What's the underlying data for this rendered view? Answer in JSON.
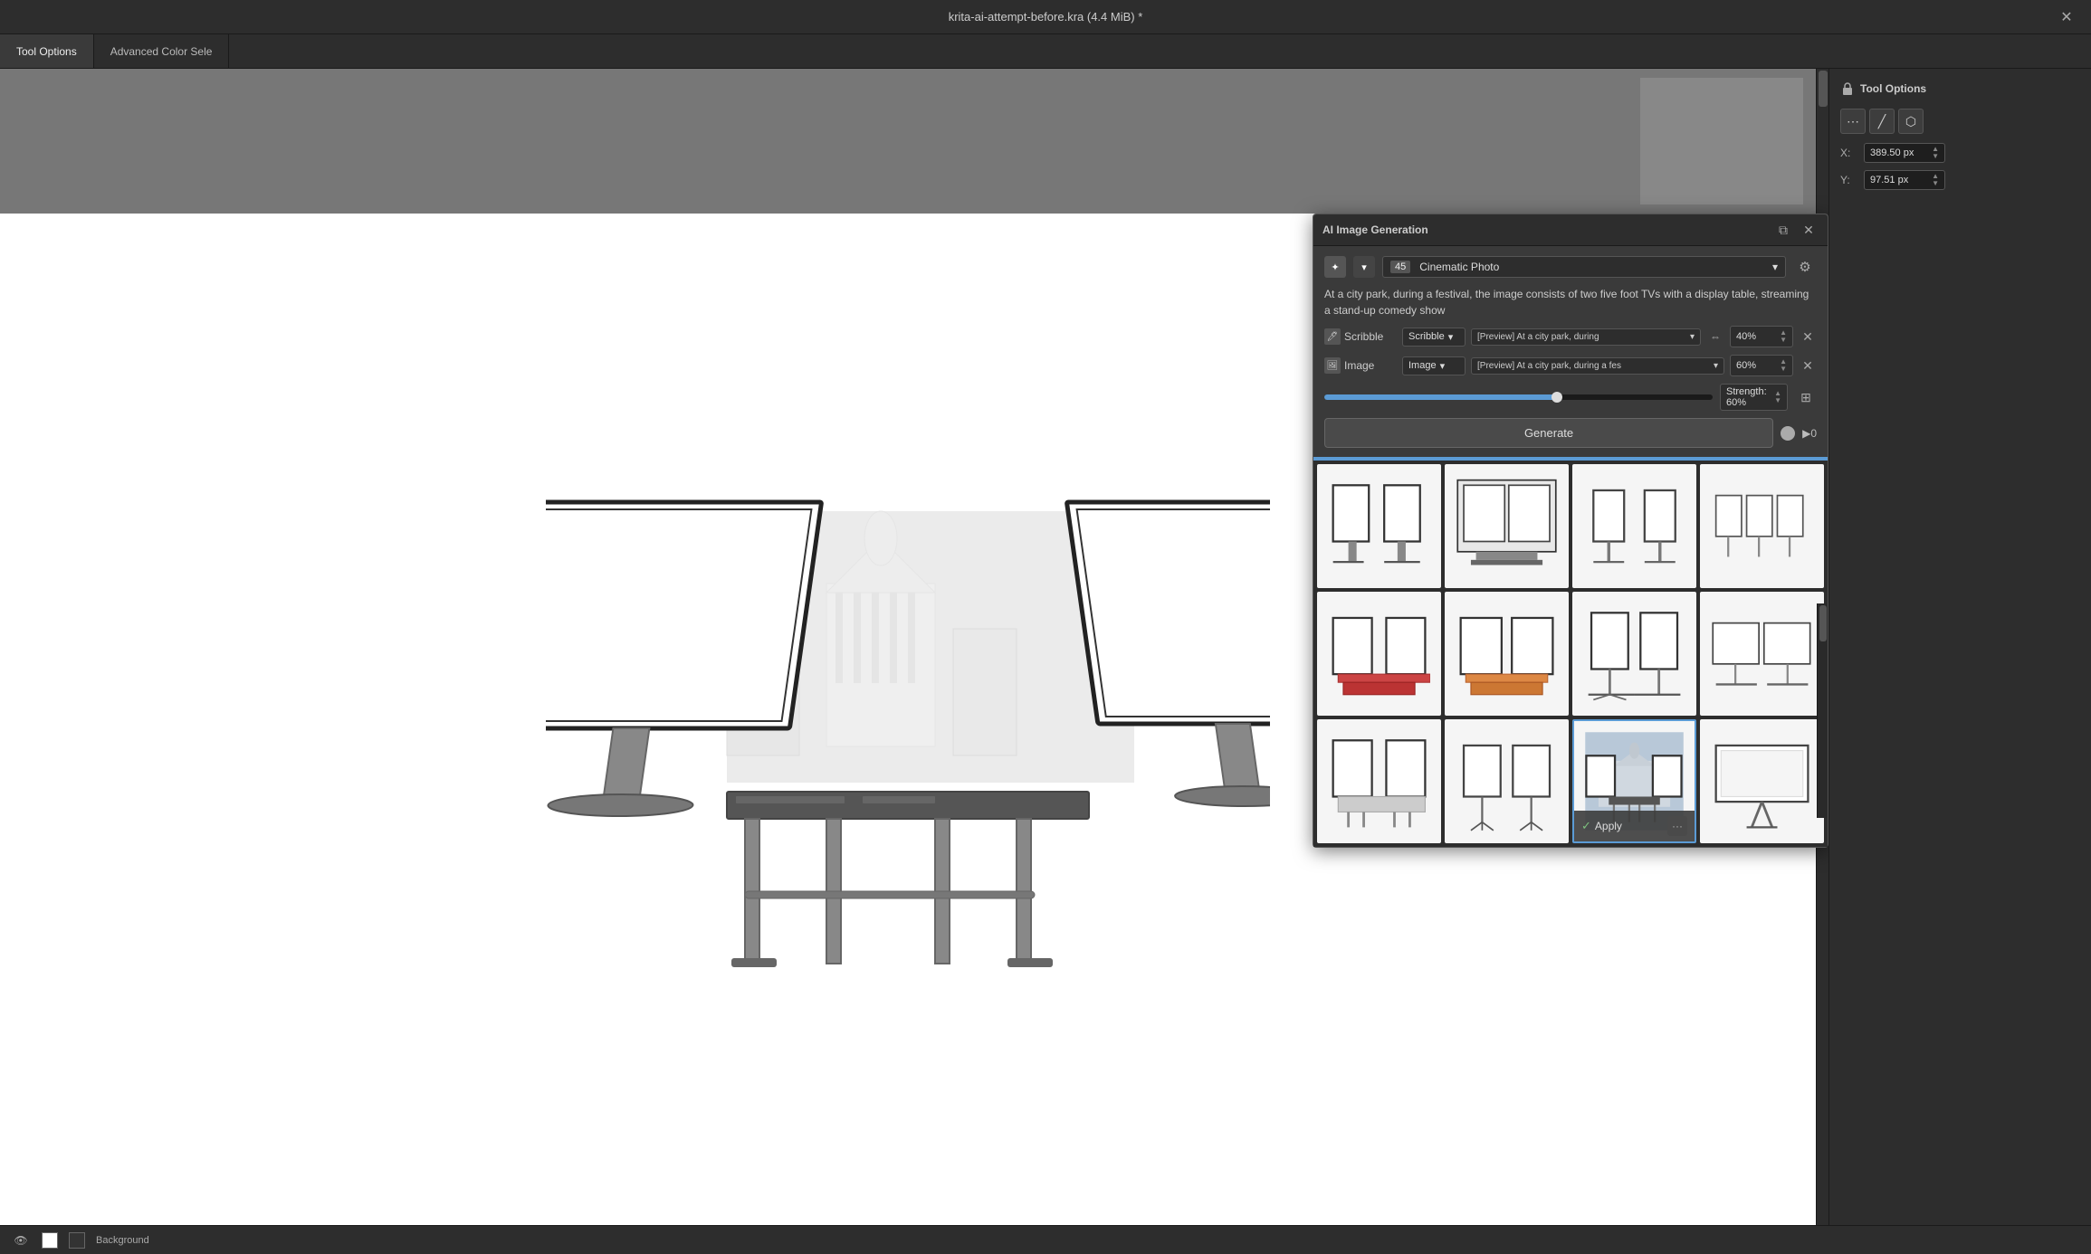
{
  "titleBar": {
    "title": "krita-ai-attempt-before.kra (4.4 MiB) *",
    "closeLabel": "✕"
  },
  "toolOptionsBar": {
    "tabs": [
      {
        "label": "Tool Options",
        "active": true
      },
      {
        "label": "Advanced Color Sele",
        "active": false
      }
    ]
  },
  "rightSidebar": {
    "title": "Tool Options",
    "toolButtons": [
      "⋯",
      "╱",
      "⬡"
    ],
    "fields": [
      {
        "label": "X:",
        "value": "389.50 px"
      },
      {
        "label": "Y:",
        "value": "97.51 px"
      }
    ]
  },
  "aiPanel": {
    "title": "AI Image Generation",
    "styleNumber": "45",
    "styleName": "Cinematic Photo",
    "promptText": "At a city park, during a festival, the image consists of two five foot TVs with a display table, streaming a stand-up comedy show",
    "scribbleLabel": "Scribble",
    "scribbleValue": "[Preview] At a city park, during",
    "scribblePercent": "40%",
    "imageLabel": "Image",
    "imageValue": "[Preview] At a city park, during a fes",
    "imagePercent": "60%",
    "strengthLabel": "Strength: 60%",
    "strengthPercent": 60,
    "generateLabel": "Generate",
    "generateCount": "▶0",
    "applyLabel": "Apply"
  },
  "gridItems": [
    {
      "id": 1,
      "selected": false,
      "type": "tv-stands-light"
    },
    {
      "id": 2,
      "selected": false,
      "type": "tv-room"
    },
    {
      "id": 3,
      "selected": false,
      "type": "tv-minimal"
    },
    {
      "id": 4,
      "selected": false,
      "type": "tv-small"
    },
    {
      "id": 5,
      "selected": false,
      "type": "tv-red-desk"
    },
    {
      "id": 6,
      "selected": false,
      "type": "tv-orange-desk"
    },
    {
      "id": 7,
      "selected": false,
      "type": "tv-dual-stand"
    },
    {
      "id": 8,
      "selected": false,
      "type": "tv-wide"
    },
    {
      "id": 9,
      "selected": false,
      "type": "tv-park-scene"
    },
    {
      "id": 10,
      "selected": false,
      "type": "tv-tripod"
    },
    {
      "id": 11,
      "selected": true,
      "type": "tv-selected"
    },
    {
      "id": 12,
      "selected": false,
      "type": "tv-billboard"
    }
  ],
  "bottomBar": {
    "layerLabel": "Background"
  }
}
